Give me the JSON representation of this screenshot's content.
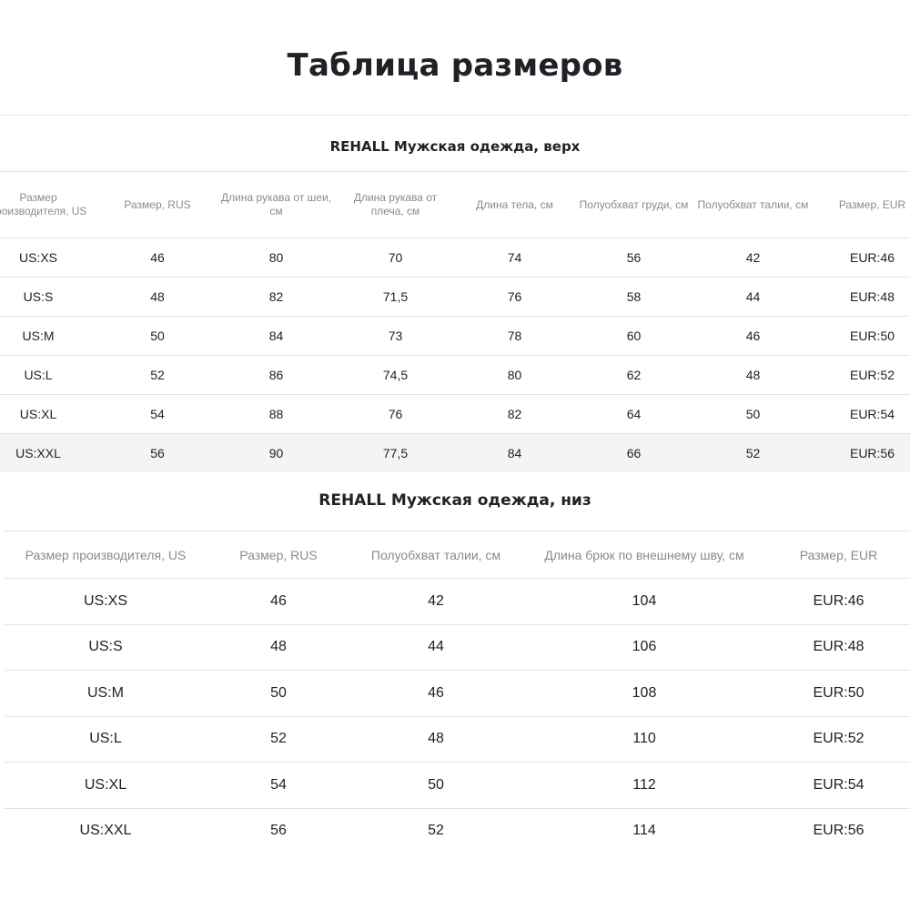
{
  "title": "Таблица размеров",
  "top": {
    "title": "REHALL Мужская одежда, верх",
    "headers": [
      "Размер производителя, US",
      "Размер, RUS",
      "Длина рукава от шеи, см",
      "Длина рукава от плеча, см",
      "Длина тела, см",
      "Полуобхват груди, см",
      "Полуобхват талии, см",
      "Размер, EUR"
    ],
    "rows": [
      [
        "US:XS",
        "46",
        "80",
        "70",
        "74",
        "56",
        "42",
        "EUR:46"
      ],
      [
        "US:S",
        "48",
        "82",
        "71,5",
        "76",
        "58",
        "44",
        "EUR:48"
      ],
      [
        "US:M",
        "50",
        "84",
        "73",
        "78",
        "60",
        "46",
        "EUR:50"
      ],
      [
        "US:L",
        "52",
        "86",
        "74,5",
        "80",
        "62",
        "48",
        "EUR:52"
      ],
      [
        "US:XL",
        "54",
        "88",
        "76",
        "82",
        "64",
        "50",
        "EUR:54"
      ],
      [
        "US:XXL",
        "56",
        "90",
        "77,5",
        "84",
        "66",
        "52",
        "EUR:56"
      ]
    ]
  },
  "bottom": {
    "title": "REHALL Мужская одежда, низ",
    "headers": [
      "Размер производителя, US",
      "Размер, RUS",
      "Полуобхват талии, см",
      "Длина брюк по внешнему шву, см",
      "Размер, EUR"
    ],
    "rows": [
      [
        "US:XS",
        "46",
        "42",
        "104",
        "EUR:46"
      ],
      [
        "US:S",
        "48",
        "44",
        "106",
        "EUR:48"
      ],
      [
        "US:M",
        "50",
        "46",
        "108",
        "EUR:50"
      ],
      [
        "US:L",
        "52",
        "48",
        "110",
        "EUR:52"
      ],
      [
        "US:XL",
        "54",
        "50",
        "112",
        "EUR:54"
      ],
      [
        "US:XXL",
        "56",
        "52",
        "114",
        "EUR:56"
      ]
    ]
  }
}
